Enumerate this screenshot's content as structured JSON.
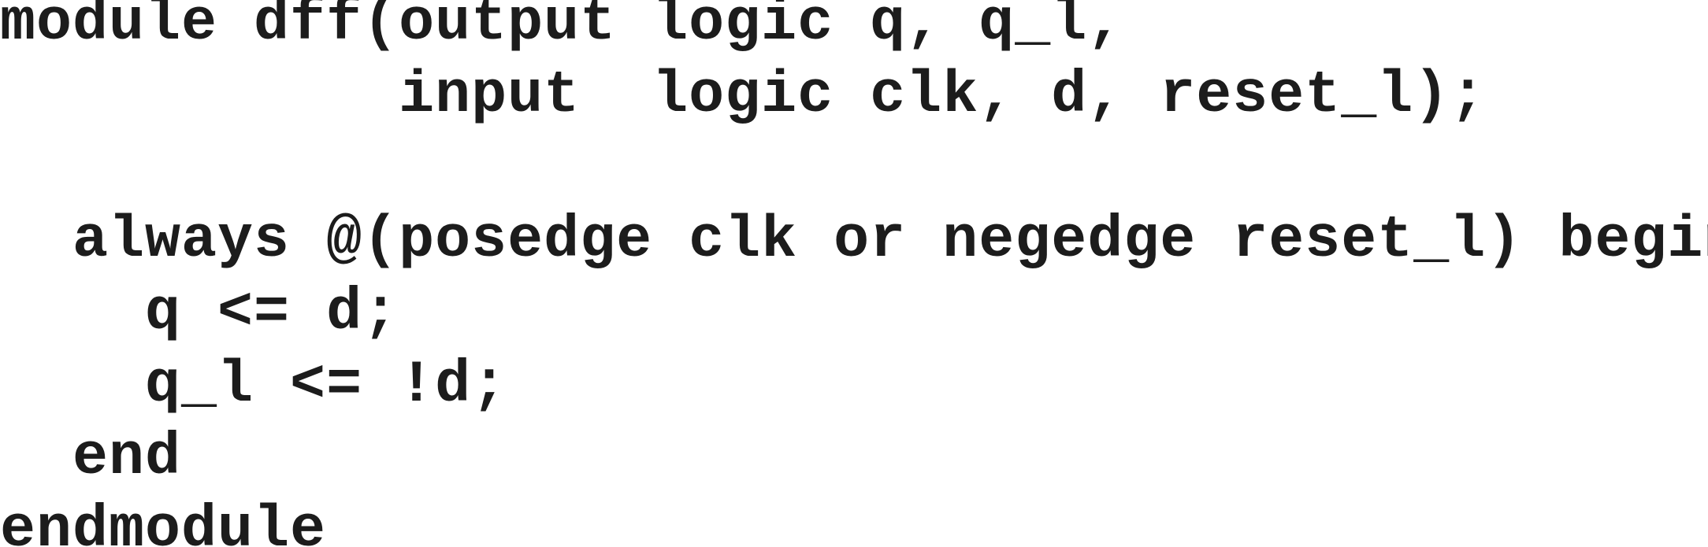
{
  "code": {
    "lines": [
      "module dff(output logic q, q_l,",
      "           input  logic clk, d, reset_l);",
      "",
      "  always @(posedge clk or negedge reset_l) begin",
      "    q <= d;",
      "    q_l <= !d;",
      "  end",
      "endmodule"
    ]
  }
}
